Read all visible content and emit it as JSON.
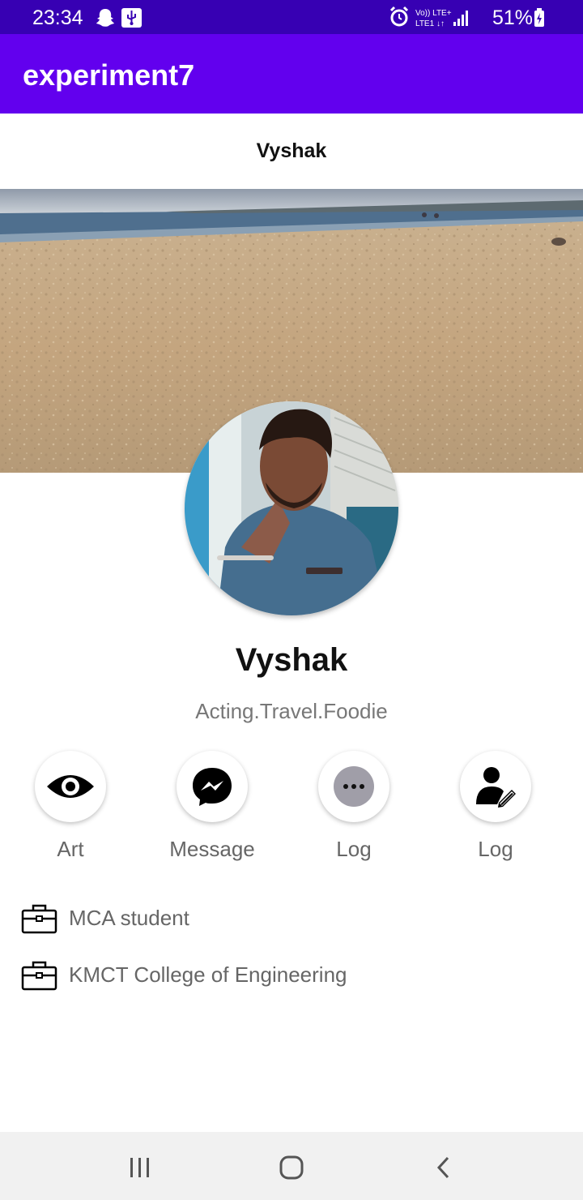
{
  "status_bar": {
    "time": "23:34",
    "network_label": "Vo)) LTE+ LTE1",
    "battery": "51%",
    "icons": [
      "snapchat-icon",
      "usb-icon",
      "alarm-icon",
      "signal-icon",
      "battery-charging-icon"
    ]
  },
  "app_bar": {
    "title": "experiment7"
  },
  "profile": {
    "header_name": "Vyshak",
    "display_name": "Vyshak",
    "bio": "Acting.Travel.Foodie"
  },
  "actions": [
    {
      "label": "Art",
      "icon": "eye-icon"
    },
    {
      "label": "Message",
      "icon": "messenger-icon"
    },
    {
      "label": "Log",
      "icon": "more-icon"
    },
    {
      "label": "Log",
      "icon": "edit-user-icon"
    }
  ],
  "info": [
    {
      "text": "MCA student",
      "icon": "briefcase-icon"
    },
    {
      "text": "KMCT College of Engineering",
      "icon": "briefcase-icon"
    }
  ],
  "nav": {
    "icons": [
      "recents-icon",
      "home-icon",
      "back-icon"
    ]
  },
  "colors": {
    "status_bar": "#3700b3",
    "app_bar": "#6200ee",
    "nav_bar": "#f1f1f1",
    "secondary_text": "#777777"
  }
}
